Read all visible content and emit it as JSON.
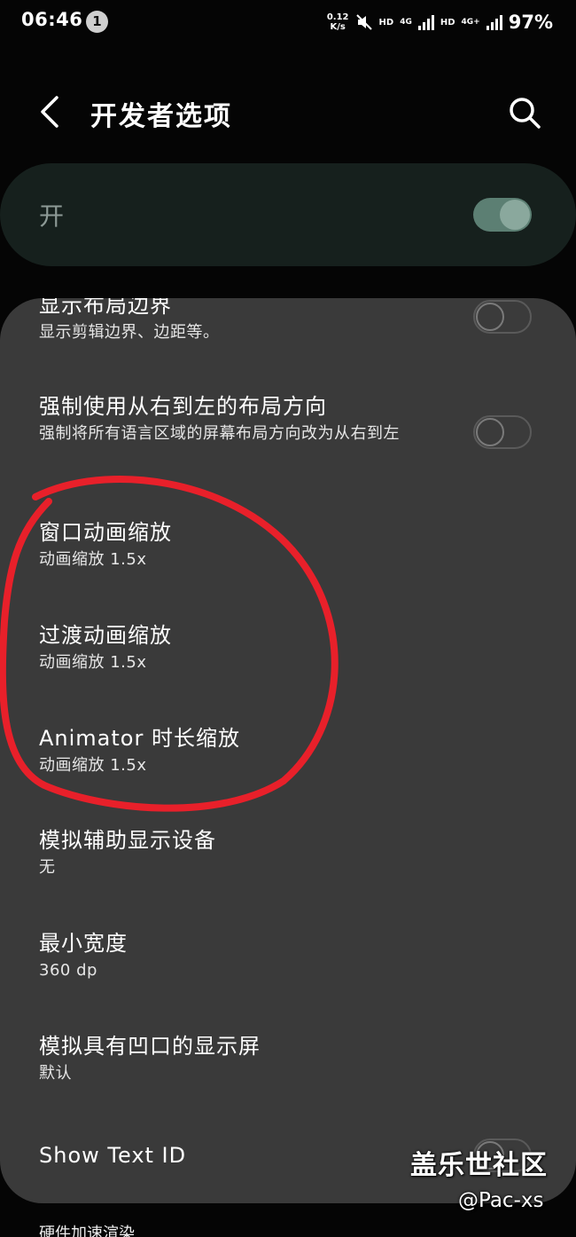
{
  "status_bar": {
    "time": "06:46",
    "notification_count": "1",
    "net_speed_value": "0.12",
    "net_speed_unit": "K/s",
    "hd1": "HD",
    "net1": "4G",
    "hd2": "HD",
    "net2": "4G+",
    "battery": "97%"
  },
  "header": {
    "title": "开发者选项"
  },
  "master_switch": {
    "label": "开",
    "state": "on"
  },
  "settings": [
    {
      "title": "显示布局边界",
      "subtitle": "显示剪辑边界、边距等。",
      "toggle": "off"
    },
    {
      "title": "强制使用从右到左的布局方向",
      "subtitle": "强制将所有语言区域的屏幕布局方向改为从右到左",
      "toggle": "off"
    },
    {
      "title": "窗口动画缩放",
      "subtitle": "动画缩放 1.5x"
    },
    {
      "title": "过渡动画缩放",
      "subtitle": "动画缩放 1.5x"
    },
    {
      "title": "Animator 时长缩放",
      "subtitle": "动画缩放 1.5x"
    },
    {
      "title": "模拟辅助显示设备",
      "subtitle": "无"
    },
    {
      "title": "最小宽度",
      "subtitle": "360 dp"
    },
    {
      "title": "模拟具有凹口的显示屏",
      "subtitle": "默认"
    },
    {
      "title": "Show Text ID",
      "toggle": "off"
    }
  ],
  "bottom_partial": "硬件加速渲染",
  "watermark": {
    "line1": "盖乐世社区",
    "line2": "@Pac-xs"
  },
  "colors": {
    "background": "#050505",
    "panel": "#3a3a3a",
    "master_card": "#16201d",
    "toggle_on": "#5c7f73",
    "annotation": "#e8202a"
  }
}
